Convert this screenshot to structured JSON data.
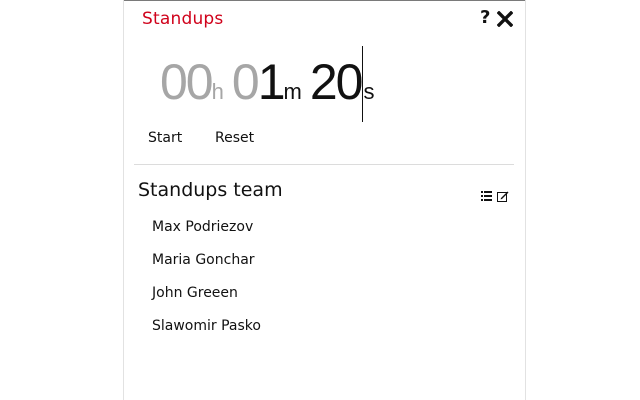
{
  "app": {
    "title": "Standups"
  },
  "header_icons": {
    "help": "question-icon",
    "close": "close-icon"
  },
  "timer": {
    "hours": "00",
    "hours_unit": "h",
    "minutes_lead": "0",
    "minutes_main": "1",
    "minutes_unit": "m",
    "seconds": "20",
    "seconds_unit": "s"
  },
  "controls": {
    "start_label": "Start",
    "reset_label": "Reset"
  },
  "team": {
    "title": "Standups team",
    "icons": {
      "list": "list-icon",
      "edit": "edit-icon"
    },
    "members": [
      "Max Podriezov",
      "Maria Gonchar",
      "John Greeen",
      "Slawomir Pasko"
    ]
  },
  "colors": {
    "title": "#d0021b",
    "dim_digits": "#a6a6a6",
    "text": "#111111"
  }
}
